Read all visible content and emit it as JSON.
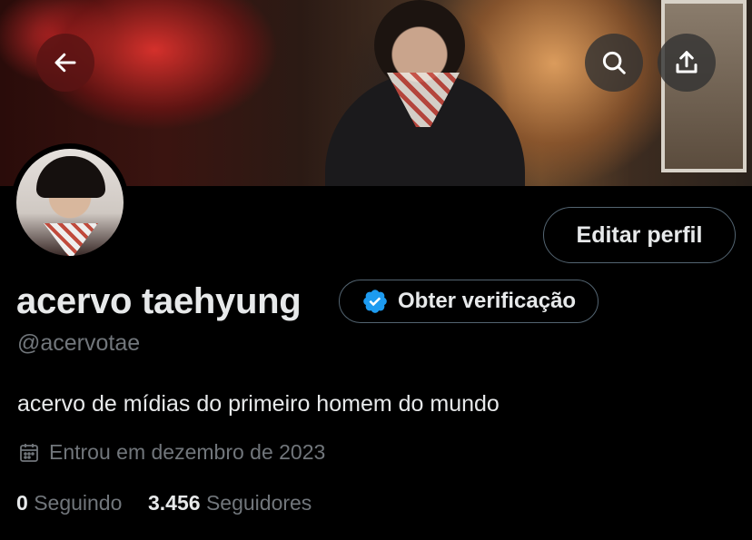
{
  "header": {
    "back_icon": "arrow-left-icon",
    "search_icon": "search-icon",
    "share_icon": "share-upload-icon"
  },
  "profile": {
    "display_name": "acervo taehyung",
    "handle": "@acervotae",
    "bio": "acervo de mídias do primeiro homem do mundo",
    "joined": "Entrou em dezembro de 2023",
    "following_count": "0",
    "following_label": "Seguindo",
    "followers_count": "3.456",
    "followers_label": "Seguidores"
  },
  "actions": {
    "edit_profile": "Editar perfil",
    "get_verified": "Obter verificação"
  },
  "colors": {
    "background": "#000000",
    "primary_text": "#e7e9ea",
    "secondary_text": "#71767b",
    "border": "#536471",
    "verified_blue": "#1d9bf0"
  }
}
